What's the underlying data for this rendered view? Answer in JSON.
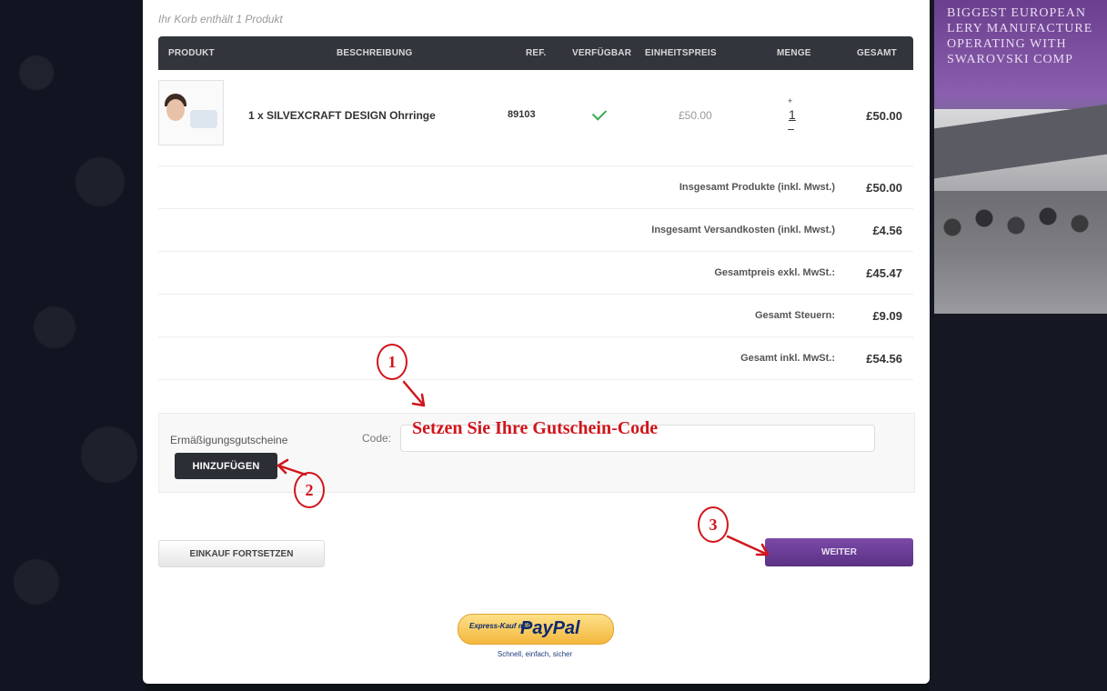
{
  "banner": {
    "text_lines": [
      "BIGGEST EUROPEAN",
      "LERY MANUFACTURE",
      "OPERATING WITH",
      "SWAROVSKI COMP"
    ]
  },
  "cart": {
    "basket_info": "Ihr Korb enthält 1 Produkt",
    "columns": {
      "product": "PRODUKT",
      "description": "BESCHREIBUNG",
      "ref": "REF.",
      "available": "VERFÜGBAR",
      "unit_price": "EINHEITSPREIS",
      "quantity": "MENGE",
      "total": "GESAMT"
    },
    "item": {
      "name": "1 x SILVEXCRAFT DESIGN Ohrringe",
      "ref": "89103",
      "available_icon": "check-icon",
      "unit_price": "£50.00",
      "qty_plus": "+",
      "quantity": "1",
      "total": "£50.00"
    },
    "summary": [
      {
        "label": "Insgesamt Produkte (inkl. Mwst.)",
        "value": "£50.00"
      },
      {
        "label": "Insgesamt Versandkosten (inkl. Mwst.)",
        "value": "£4.56"
      },
      {
        "label": "Gesamtpreis exkl. MwSt.:",
        "value": "£45.47"
      },
      {
        "label": "Gesamt Steuern:",
        "value": "£9.09"
      },
      {
        "label": "Gesamt inkl. MwSt.:",
        "value": "£54.56"
      }
    ]
  },
  "voucher": {
    "label": "Ermäßigungsgutscheine",
    "code_label": "Code:",
    "code_value": "",
    "add_button": "HINZUFÜGEN"
  },
  "actions": {
    "continue_shopping": "EINKAUF FORTSETZEN",
    "next": "WEITER"
  },
  "paypal": {
    "small": "Express-Kauf mit",
    "logo": "PayPal",
    "tagline": "Schnell, einfach, sicher"
  },
  "annotations": {
    "step1": "1",
    "step2": "2",
    "step3": "3",
    "hint": "Setzen Sie Ihre Gutschein-Code",
    "color": "#d0151b"
  },
  "colors": {
    "header_bg": "#33353d",
    "accent_purple": "#5b3183",
    "check_green": "#3aa84f"
  }
}
